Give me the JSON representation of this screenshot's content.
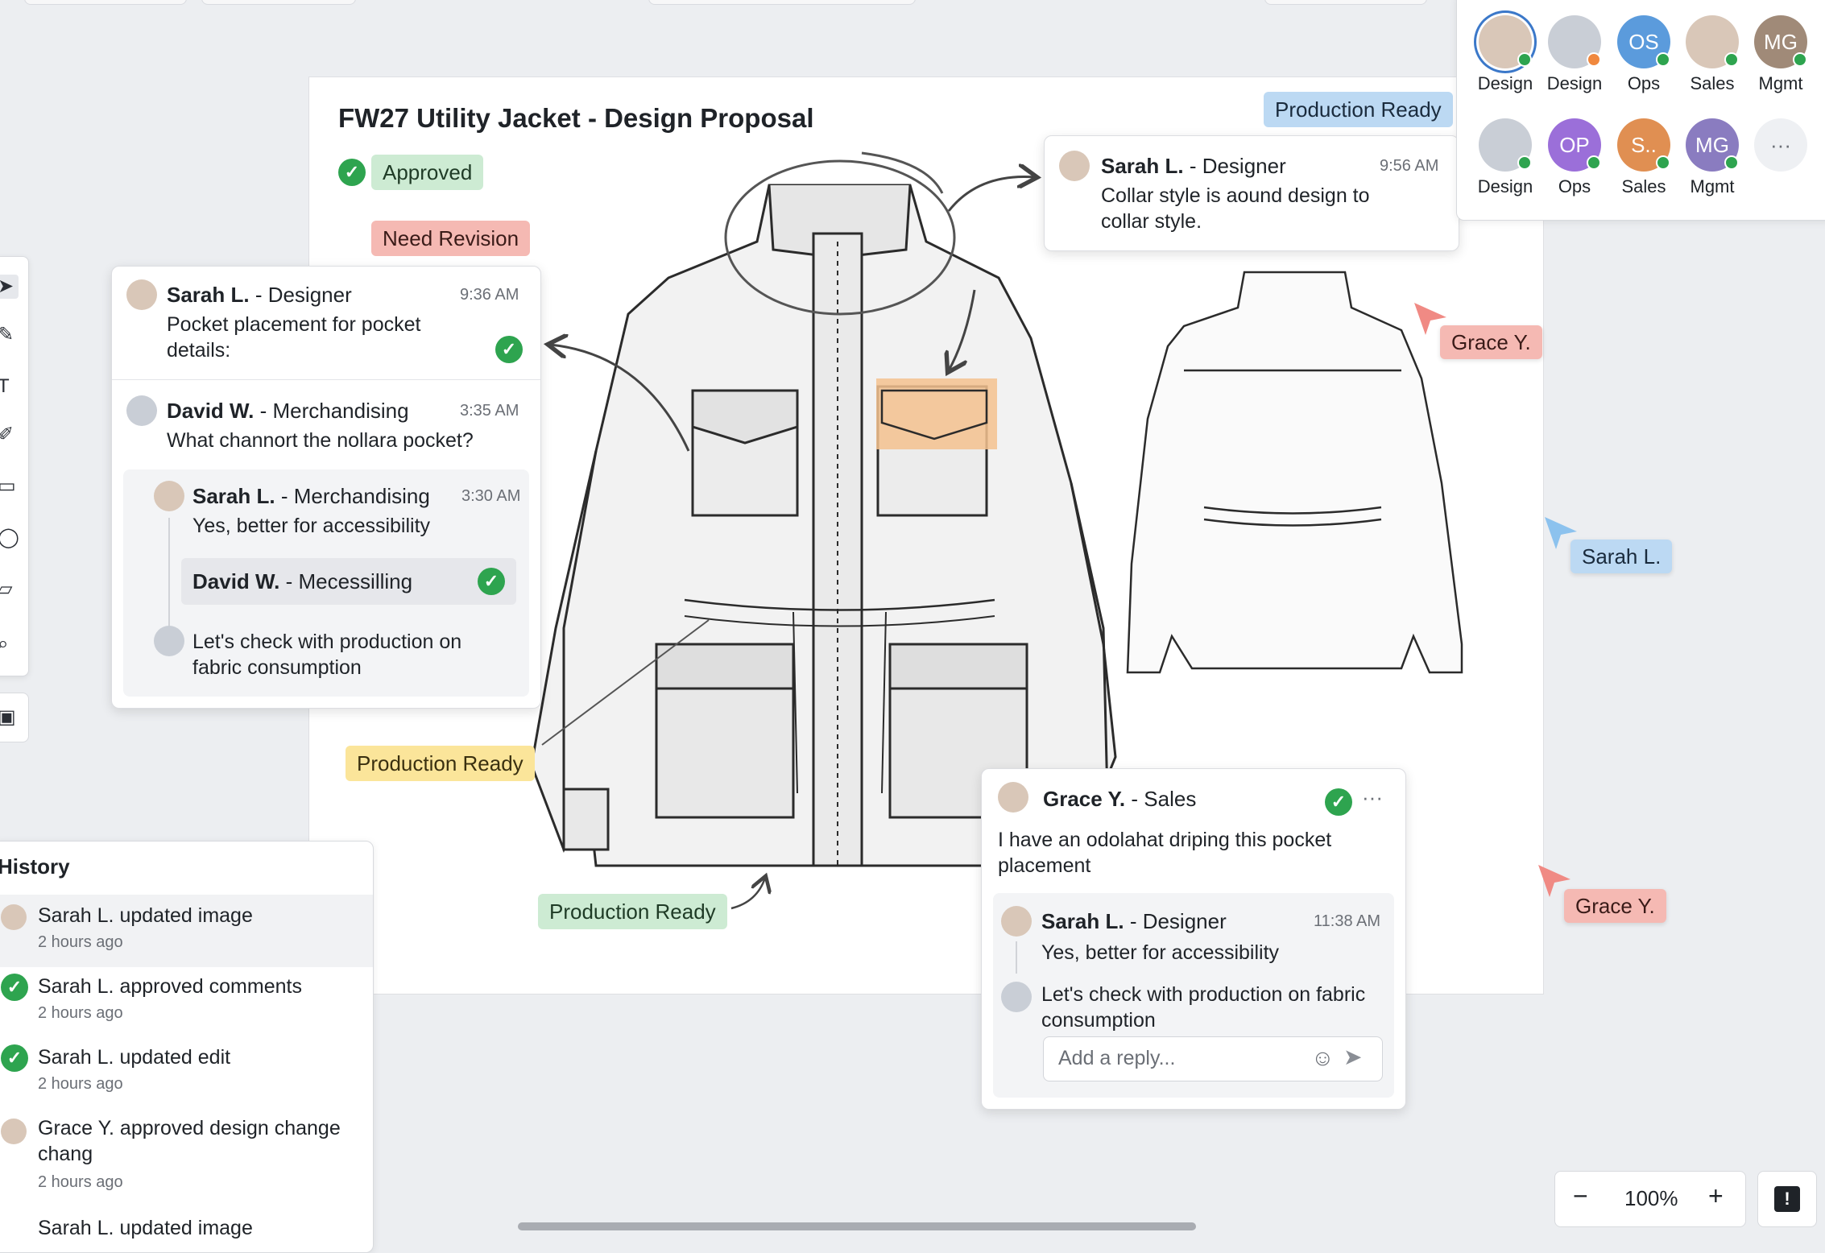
{
  "board": {
    "title": "FW27 Utility Jacket - Design Proposal",
    "tags": {
      "approved": "Approved",
      "need_revision": "Need Revision",
      "production_ready_top": "Production Ready",
      "production_ready_yellow": "Production Ready",
      "production_ready_green": "Production Ready"
    }
  },
  "thread_left": {
    "c1": {
      "author": "Sarah L.",
      "role": " - Designer",
      "time": "9:36 AM",
      "text": "Pocket placement for pocket details:"
    },
    "c2": {
      "author": "David W.",
      "role": " - Merchandising",
      "time": "3:35 AM",
      "text": "What channort the nollara pocket?"
    },
    "c3": {
      "author": "Sarah L.",
      "role": " - Merchandising",
      "time": "3:30 AM",
      "text": "Yes, better for accessibility"
    },
    "c4": {
      "author": "David W.",
      "role": " - Mecessilling"
    },
    "c5": {
      "text": "Let's check with production on fabric consumption"
    }
  },
  "thread_top": {
    "author": "Sarah L.",
    "role": " - Designer",
    "time": "9:56 AM",
    "text": "Collar style is aound design to collar style."
  },
  "thread_bottom": {
    "c1": {
      "author": "Grace Y.",
      "role": " - Sales",
      "text": "I have an odolahat driping this pocket placement"
    },
    "c2": {
      "author": "Sarah L.",
      "role": " - Designer",
      "time": "11:38 AM",
      "text": "Yes, better for accessibility"
    },
    "c3": {
      "text": "Let's check with production on fabric consumption"
    },
    "reply_placeholder": "Add a reply...",
    "more": "···"
  },
  "history": {
    "title": "History",
    "items": [
      {
        "text": "Sarah L. updated image",
        "time": "2 hours ago"
      },
      {
        "text": "Sarah L. approved comments",
        "time": "2 hours ago"
      },
      {
        "text": "Sarah L. updated edit",
        "time": "2 hours ago"
      },
      {
        "text": "Grace Y. approved design change chang",
        "time": "2 hours ago"
      },
      {
        "text": "Sarah L. updated image",
        "time": ""
      }
    ]
  },
  "presence": {
    "row1": [
      {
        "label": "Design",
        "initials": "",
        "color": "#d9c7b8",
        "status": "#2ea44f"
      },
      {
        "label": "Design",
        "initials": "",
        "color": "#c9ced6",
        "status": "#f0883e"
      },
      {
        "label": "Ops",
        "initials": "OS",
        "color": "#5b9bdc",
        "status": "#2ea44f"
      },
      {
        "label": "Sales",
        "initials": "",
        "color": "#d9c7b8",
        "status": "#2ea44f"
      },
      {
        "label": "Mgmt",
        "initials": "MG",
        "color": "#a08a78",
        "status": "#2ea44f"
      }
    ],
    "row2": [
      {
        "label": "Design",
        "initials": "",
        "color": "#c9ced6",
        "status": "#2ea44f"
      },
      {
        "label": "Ops",
        "initials": "OP",
        "color": "#9b6fd9",
        "status": "#2ea44f"
      },
      {
        "label": "Sales",
        "initials": "S..",
        "color": "#e08f52",
        "status": "#2ea44f"
      },
      {
        "label": "Mgmt",
        "initials": "MG",
        "color": "#8a7cc0",
        "status": "#2ea44f"
      }
    ],
    "more": "···"
  },
  "cursors": {
    "grace_top": "Grace Y.",
    "sarah": "Sarah L.",
    "grace_bottom": "Grace Y."
  },
  "zoom": {
    "minus": "−",
    "level": "100%",
    "plus": "+"
  },
  "colors": {
    "approved_green": "#2ea44f",
    "highlight_orange": "#f5c28f",
    "cursor_red": "#f08a84",
    "cursor_blue": "#8cc2ee"
  }
}
